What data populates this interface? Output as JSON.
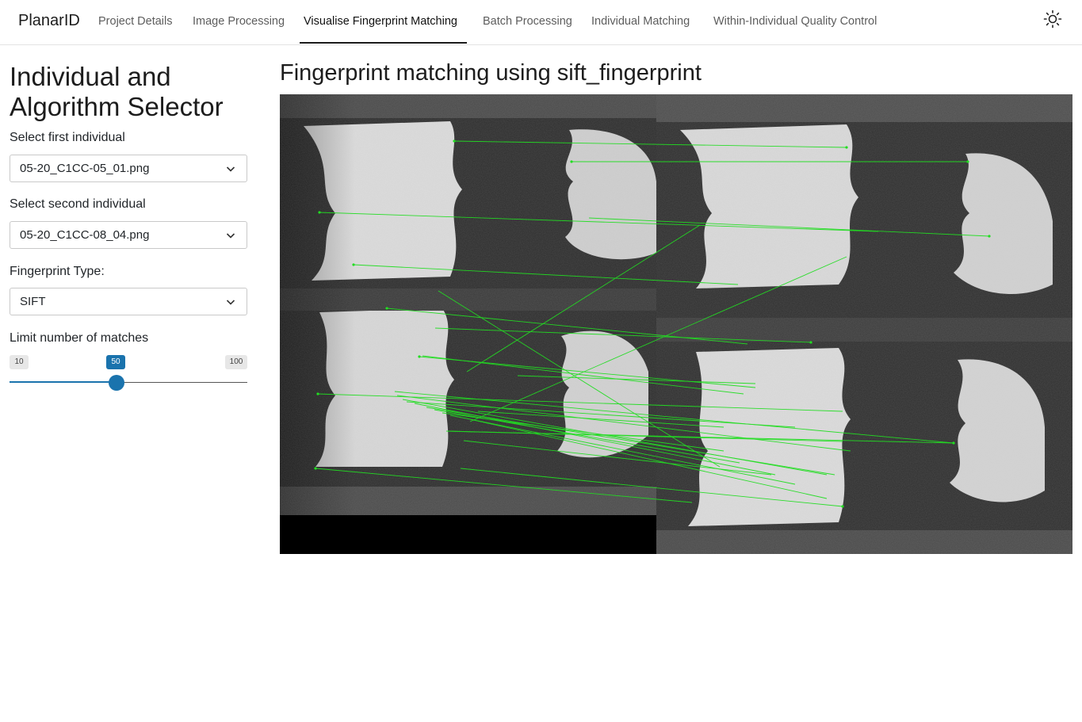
{
  "app": {
    "brand": "PlanarID"
  },
  "nav": {
    "items": [
      {
        "label": "Project Details"
      },
      {
        "label": "Image Processing"
      },
      {
        "label": "Visualise Fingerprint Matching"
      },
      {
        "label": "Batch Processing"
      },
      {
        "label": "Individual Matching"
      },
      {
        "label": "Within-Individual Quality Control"
      }
    ],
    "active_index": 2,
    "theme_toggle_icon": "sun-icon"
  },
  "sidebar": {
    "title_line1": "Individual and",
    "title_line2": "Algorithm Selector",
    "first_individual": {
      "label": "Select first individual",
      "value": "05-20_C1CC-05_01.png"
    },
    "second_individual": {
      "label": "Select second individual",
      "value": "05-20_C1CC-08_04.png"
    },
    "fingerprint_type": {
      "label": "Fingerprint Type:",
      "value": "SIFT"
    },
    "match_limit": {
      "label": "Limit number of matches",
      "min": "10",
      "max": "100",
      "value": "50",
      "fraction": 0.444
    }
  },
  "main": {
    "title": "Fingerprint matching using sift_fingerprint"
  },
  "colors": {
    "accent": "#1a73ad",
    "match_lines": "#22dd22"
  }
}
